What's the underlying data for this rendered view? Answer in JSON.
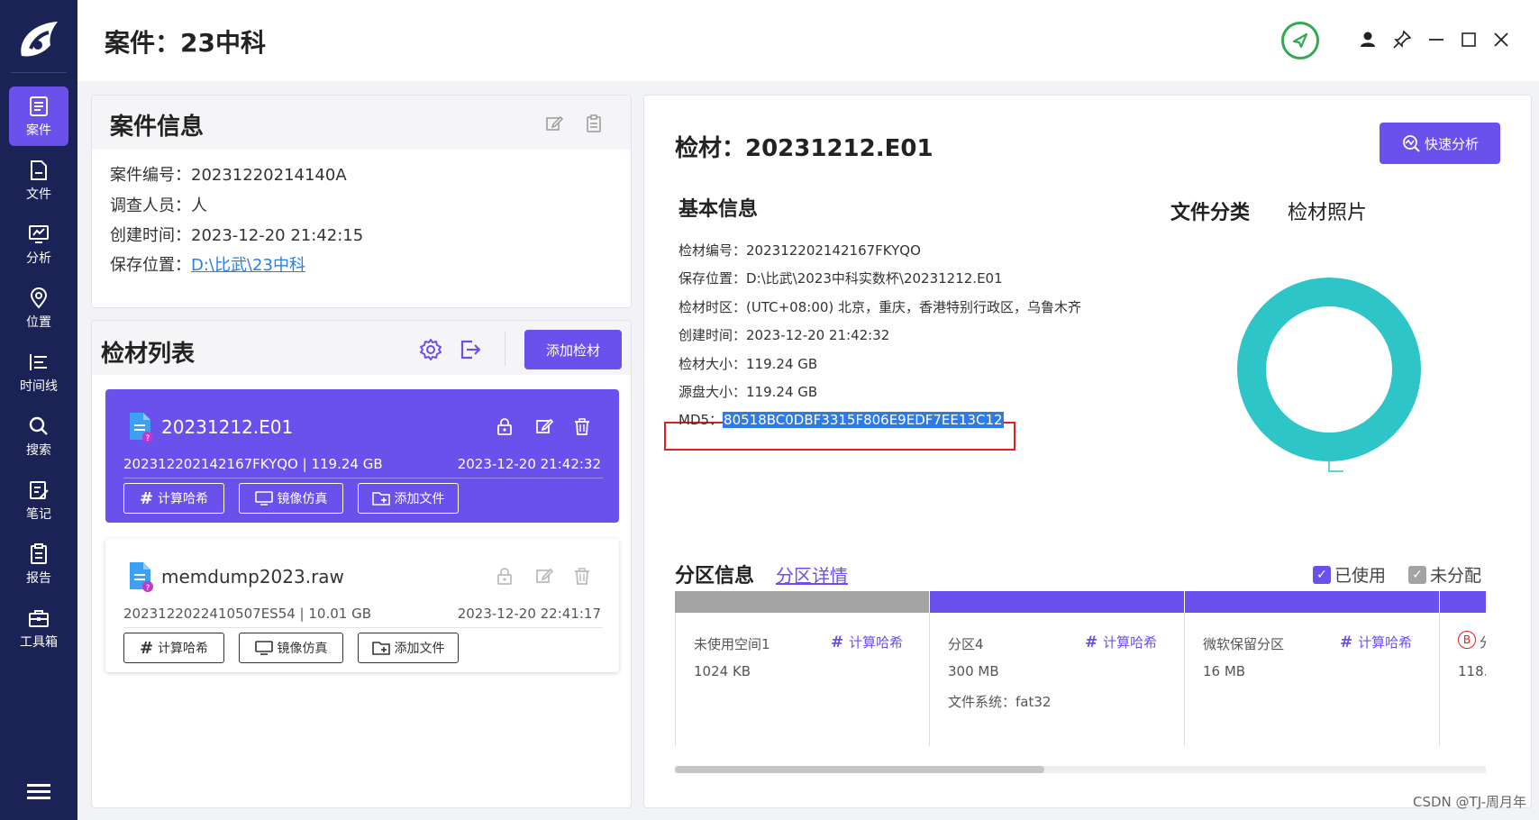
{
  "window": {
    "title": "案件：23中科",
    "controls": [
      "user-icon",
      "pin-icon",
      "minimize-icon",
      "maximize-icon",
      "close-icon"
    ]
  },
  "colors": {
    "sidebar": "#1b2356",
    "accent": "#6b51ec",
    "donut": "#2ec5c8",
    "highlight": "#2e7ae6",
    "md5_border": "#e02020",
    "status_green": "#34a853"
  },
  "sidebar": {
    "items": [
      {
        "label": "案件",
        "icon": "case-icon"
      },
      {
        "label": "文件",
        "icon": "file-icon"
      },
      {
        "label": "分析",
        "icon": "analysis-icon"
      },
      {
        "label": "位置",
        "icon": "location-icon"
      },
      {
        "label": "时间线",
        "icon": "timeline-icon"
      },
      {
        "label": "搜索",
        "icon": "search-icon"
      },
      {
        "label": "笔记",
        "icon": "note-icon"
      },
      {
        "label": "报告",
        "icon": "report-icon"
      },
      {
        "label": "工具箱",
        "icon": "toolbox-icon"
      }
    ]
  },
  "case_info": {
    "title": "案件信息",
    "rows": [
      {
        "key": "案件编号：",
        "value": "20231220214140A"
      },
      {
        "key": "调查人员：",
        "value": "人"
      },
      {
        "key": "创建时间：",
        "value": "2023-12-20 21:42:15"
      },
      {
        "key": "保存位置：",
        "value": "D:\\比武\\23中科"
      }
    ]
  },
  "evidence_list": {
    "title": "检材列表",
    "add_button": "添加检材",
    "items": [
      {
        "name": "20231212.E01",
        "meta": "202312202142167FKYQO | 119.24 GB",
        "date": "2023-12-20 21:42:32",
        "buttons": [
          "计算哈希",
          "镜像仿真",
          "添加文件"
        ]
      },
      {
        "name": "memdump2023.raw",
        "meta": "2023122022410507ES54 | 10.01 GB",
        "date": "2023-12-20 22:41:17",
        "buttons": [
          "计算哈希",
          "镜像仿真",
          "添加文件"
        ]
      }
    ]
  },
  "detail": {
    "title": "检材：20231212.E01",
    "quick_button": "快速分析",
    "basic_title": "基本信息",
    "basic": [
      {
        "key": "检材编号：",
        "value": "202312202142167FKYQO"
      },
      {
        "key": "保存位置：",
        "value": "D:\\比武\\2023中科实数杯\\20231212.E01"
      },
      {
        "key": "检材时区：",
        "value": "(UTC+08:00) 北京，重庆，香港特别行政区，乌鲁木齐"
      },
      {
        "key": "创建时间：",
        "value": "2023-12-20 21:42:32"
      },
      {
        "key": "检材大小：",
        "value": "119.24 GB"
      },
      {
        "key": "源盘大小：",
        "value": "119.24 GB"
      }
    ],
    "md5_key": "MD5：",
    "md5_value": "80518BC0DBF3315F806E9EDF7EE13C12",
    "tabs": [
      "文件分类",
      "检材照片"
    ],
    "partition_title": "分区信息",
    "partition_link": "分区详情",
    "legend": [
      "已使用",
      "未分配"
    ],
    "partitions": [
      {
        "name": "未使用空间1",
        "size": "1024 KB",
        "fs": "",
        "hash": "计算哈希",
        "color": "#a3a3a3"
      },
      {
        "name": "分区4",
        "size": "300 MB",
        "fs": "文件系统：fat32",
        "hash": "计算哈希",
        "color": "#6b51ec"
      },
      {
        "name": "微软保留分区",
        "size": "16 MB",
        "fs": "",
        "hash": "计算哈希",
        "color": "#6b51ec"
      },
      {
        "name": "分",
        "size": "118.",
        "fs": "",
        "hash": "",
        "color": "#6b51ec"
      }
    ]
  },
  "watermark": "CSDN @TJ-周月年"
}
